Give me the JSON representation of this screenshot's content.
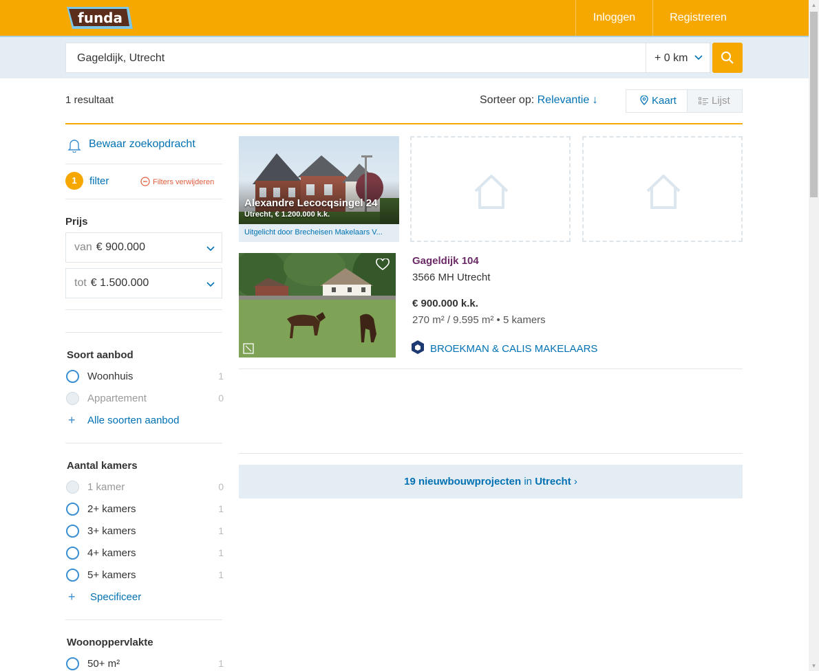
{
  "header": {
    "logo_text": "funda",
    "login_label": "Inloggen",
    "register_label": "Registreren"
  },
  "search": {
    "query": "Gageldijk, Utrecht",
    "radius": "+ 0 km"
  },
  "results": {
    "count_text": "1 resultaat",
    "sort_label": "Sorteer op:",
    "sort_value": "Relevantie ↓",
    "view_map": "Kaart",
    "view_list": "Lijst"
  },
  "sidebar": {
    "save_search": "Bewaar zoekopdracht",
    "filter_count": "1",
    "filter_label": "filter",
    "remove_filters": "Filters verwijderen",
    "price": {
      "title": "Prijs",
      "from_label": "van",
      "from_value": "€ 900.000",
      "to_label": "tot",
      "to_value": "€ 1.500.000"
    },
    "offer_type": {
      "title": "Soort aanbod",
      "options": [
        {
          "label": "Woonhuis",
          "count": "1",
          "disabled": false
        },
        {
          "label": "Appartement",
          "count": "0",
          "disabled": true
        }
      ],
      "more_link": "Alle soorten aanbod"
    },
    "rooms": {
      "title": "Aantal kamers",
      "options": [
        {
          "label": "1 kamer",
          "count": "0",
          "disabled": true
        },
        {
          "label": "2+ kamers",
          "count": "1",
          "disabled": false
        },
        {
          "label": "3+ kamers",
          "count": "1",
          "disabled": false
        },
        {
          "label": "4+ kamers",
          "count": "1",
          "disabled": false
        },
        {
          "label": "5+ kamers",
          "count": "1",
          "disabled": false
        }
      ],
      "more_link": "Specificeer"
    },
    "living_area": {
      "title": "Woonoppervlakte",
      "options": [
        {
          "label": "50+ m²",
          "count": "1",
          "disabled": false
        }
      ]
    }
  },
  "featured": {
    "title": "Alexandre Lecocqsingel 24",
    "subtitle": "Utrecht, € 1.200.000 k.k.",
    "caption": "Uitgelicht door Brecheisen Makelaars V..."
  },
  "listing": {
    "street": "Gageldijk 104",
    "postal_city": "3566 MH Utrecht",
    "price": "€ 900.000 k.k.",
    "size": "270 m² / 9.595 m² • 5 kamers",
    "agent": "BROEKMAN & CALIS MAKELAARS"
  },
  "nieuwbouw": {
    "count_text": "19 nieuwbouwprojecten",
    "in_text": "in",
    "city_text": "Utrecht",
    "arrow": "›"
  },
  "colors": {
    "brand_orange": "#f7a800",
    "link_blue": "#0071b3",
    "listing_purple": "#6b2a66",
    "band_blue": "#e4edf4"
  }
}
